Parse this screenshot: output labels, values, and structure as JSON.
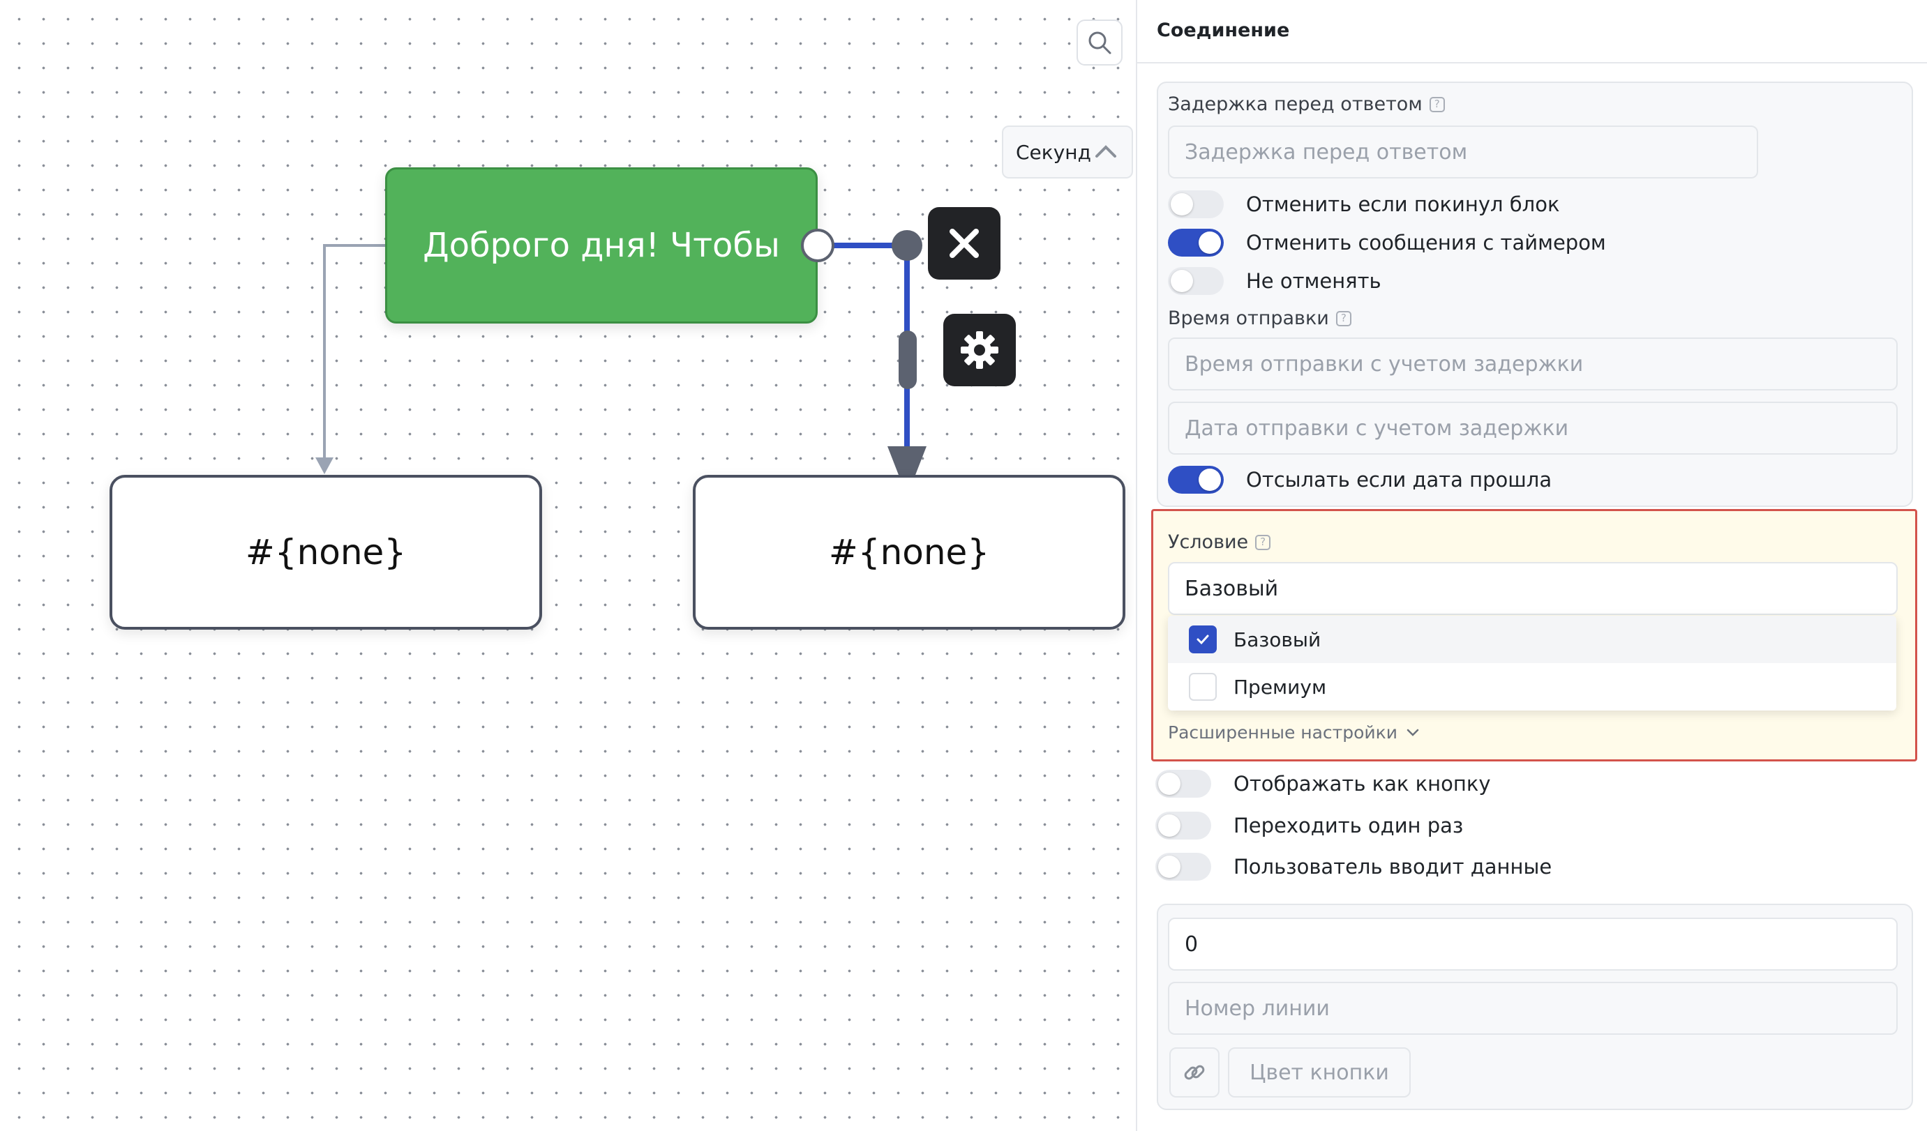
{
  "canvas": {
    "nodes": {
      "start": "Доброго дня!  Чтобы",
      "left": "#{none}",
      "right": "#{none}"
    },
    "colors": {
      "start_node": "#52b25a",
      "edge_active": "#2f4fc4",
      "edge_idle": "#9aa3b3"
    },
    "icons": {
      "delete": "close-icon",
      "settings": "gear-icon",
      "search": "search-icon"
    }
  },
  "panel": {
    "title": "Соединение",
    "delay": {
      "label": "Задержка перед ответом",
      "placeholder": "Задержка перед ответом",
      "unit": "Секунд"
    },
    "toggles_top": [
      {
        "label": "Отменить если покинул блок",
        "on": false
      },
      {
        "label": "Отменить сообщения с таймером",
        "on": true
      },
      {
        "label": "Не отменять",
        "on": false
      }
    ],
    "send_time": {
      "label": "Время отправки",
      "time_placeholder": "Время отправки с учетом задержки",
      "date_placeholder": "Дата отправки с учетом задержки"
    },
    "send_if_past": {
      "label": "Отсылать если дата прошла",
      "on": true
    },
    "condition": {
      "label": "Условие",
      "value": "Базовый",
      "options": [
        {
          "label": "Базовый",
          "checked": true
        },
        {
          "label": "Премиум",
          "checked": false
        }
      ],
      "advanced_label": "Расширенные настройки"
    },
    "toggles_bottom": [
      {
        "label": "Отображать как кнопку",
        "on": false
      },
      {
        "label": "Переходить один раз",
        "on": false
      },
      {
        "label": "Пользователь вводит данные",
        "on": false
      }
    ],
    "line": {
      "value": "0",
      "line_placeholder": "Номер линии",
      "color_button": "Цвет кнопки"
    }
  }
}
